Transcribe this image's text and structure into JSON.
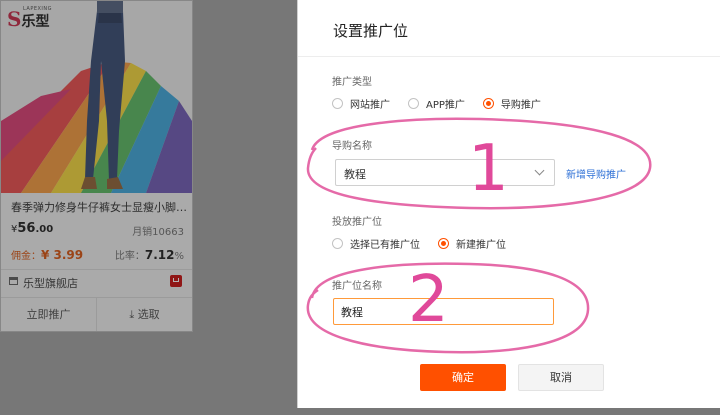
{
  "product": {
    "brand_cn": "乐型",
    "brand_en": "LAPEXING",
    "title": "春季弹力修身牛仔裤女士显瘦小脚…",
    "price_symbol": "¥",
    "price_int": "56",
    "price_dec": ".00",
    "sales": "月销10663",
    "commission_label": "佣金：",
    "commission_value": "¥ 3.99",
    "rate_label": "比率：",
    "rate_value": "7.12",
    "rate_unit": "%",
    "shop": "乐型旗舰店",
    "promote_label": "立即推广",
    "select_label": "选取"
  },
  "modal": {
    "title": "设置推广位",
    "type_label": "推广类型",
    "type_options": [
      {
        "label": "网站推广",
        "selected": false
      },
      {
        "label": "APP推广",
        "selected": false
      },
      {
        "label": "导购推广",
        "selected": true
      }
    ],
    "guide_name_label": "导购名称",
    "guide_name_value": "教程",
    "add_guide_link": "新增导购推广",
    "position_label": "投放推广位",
    "position_options": [
      {
        "label": "选择已有推广位",
        "selected": false
      },
      {
        "label": "新建推广位",
        "selected": true
      }
    ],
    "position_name_label": "推广位名称",
    "position_name_value": "教程",
    "ok_label": "确定",
    "cancel_label": "取消"
  },
  "annotations": {
    "step1": "1",
    "step2": "2",
    "color": "#e0499a"
  },
  "colors": {
    "accent": "#ff5000",
    "link": "#2c6fd6",
    "overlay": "#9b9b9b"
  }
}
